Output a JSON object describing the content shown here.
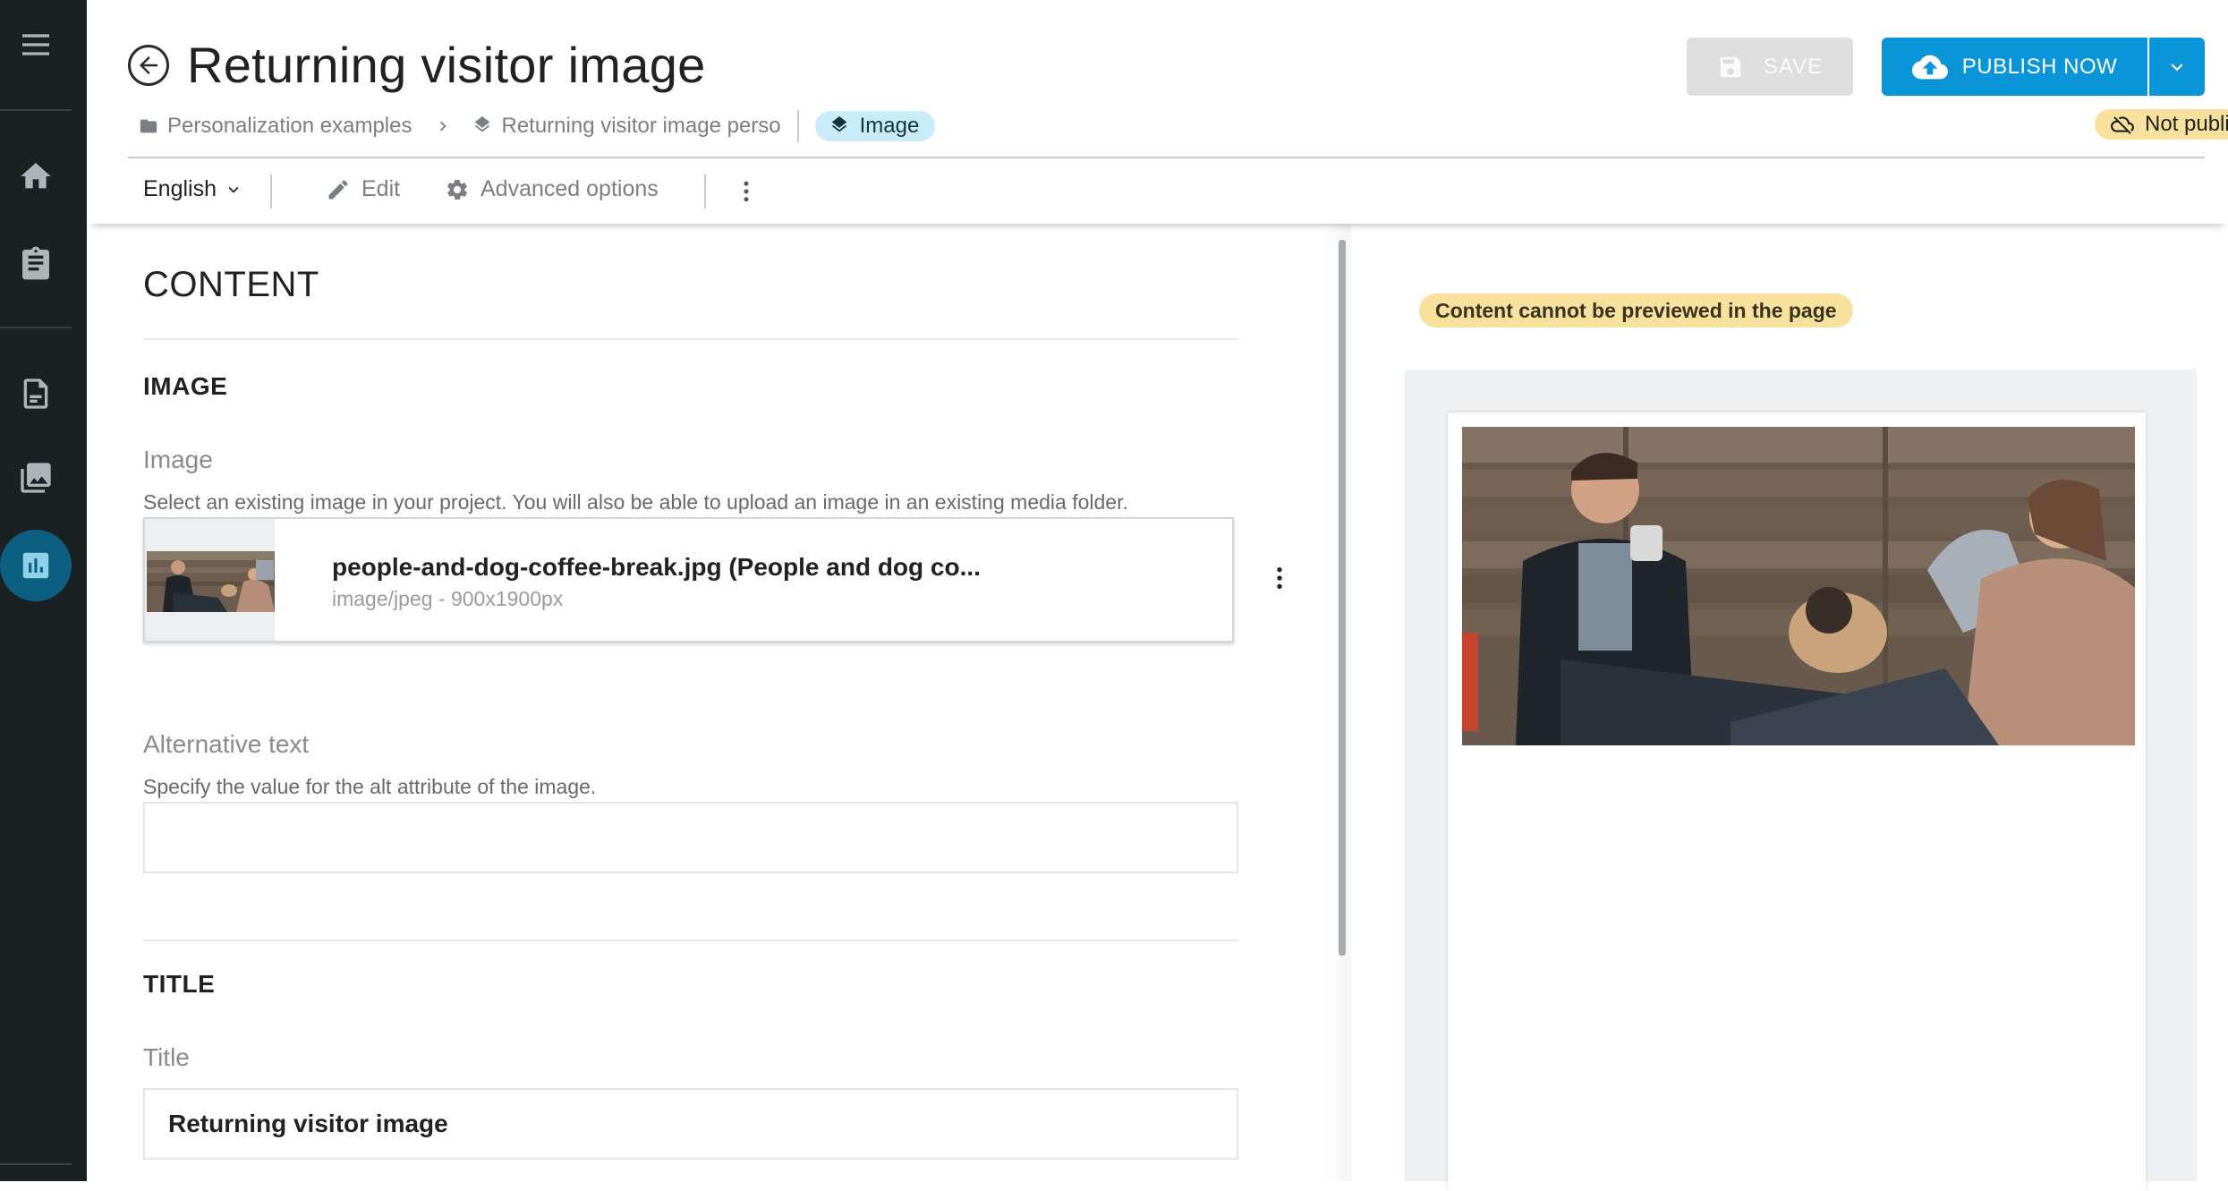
{
  "header": {
    "title": "Returning visitor image",
    "breadcrumb": {
      "folder": "Personalization examples",
      "item": "Returning visitor image perso",
      "type": "Image"
    },
    "save_label": "SAVE",
    "publish_label": "PUBLISH NOW",
    "status": "Not published"
  },
  "toolbar": {
    "language": "English",
    "edit_label": "Edit",
    "advanced_label": "Advanced options"
  },
  "content": {
    "section_title": "CONTENT",
    "image_group": {
      "title": "IMAGE",
      "image_label": "Image",
      "image_help": "Select an existing image in your project. You will also be able to upload an image in an existing media folder.",
      "asset_name": "people-and-dog-coffee-break.jpg (People and dog co...",
      "asset_meta": "image/jpeg - 900x1900px",
      "alt_label": "Alternative text",
      "alt_help": "Specify the value for the alt attribute of the image.",
      "alt_value": ""
    },
    "title_group": {
      "title": "TITLE",
      "title_label": "Title",
      "title_value": "Returning visitor image"
    }
  },
  "preview": {
    "warning": "Content cannot be previewed in the page"
  },
  "colors": {
    "rail": "#1b2023",
    "accent": "#0a95d8",
    "active_nav": "#0b5f80",
    "badge_yellow": "#f7e19c",
    "type_pill": "#c9ecfb"
  },
  "icons": {
    "rail": [
      "menu-icon",
      "home-icon",
      "clipboard-icon",
      "content-items-icon",
      "media-icon",
      "analytics-icon"
    ],
    "header": [
      "back-arrow-icon",
      "folder-icon",
      "chevron-right-icon",
      "layers-icon",
      "save-icon",
      "cloud-upload-icon",
      "chevron-down-icon",
      "cloud-off-icon"
    ],
    "toolbar": [
      "pencil-icon",
      "gear-icon",
      "more-vertical-icon"
    ]
  }
}
